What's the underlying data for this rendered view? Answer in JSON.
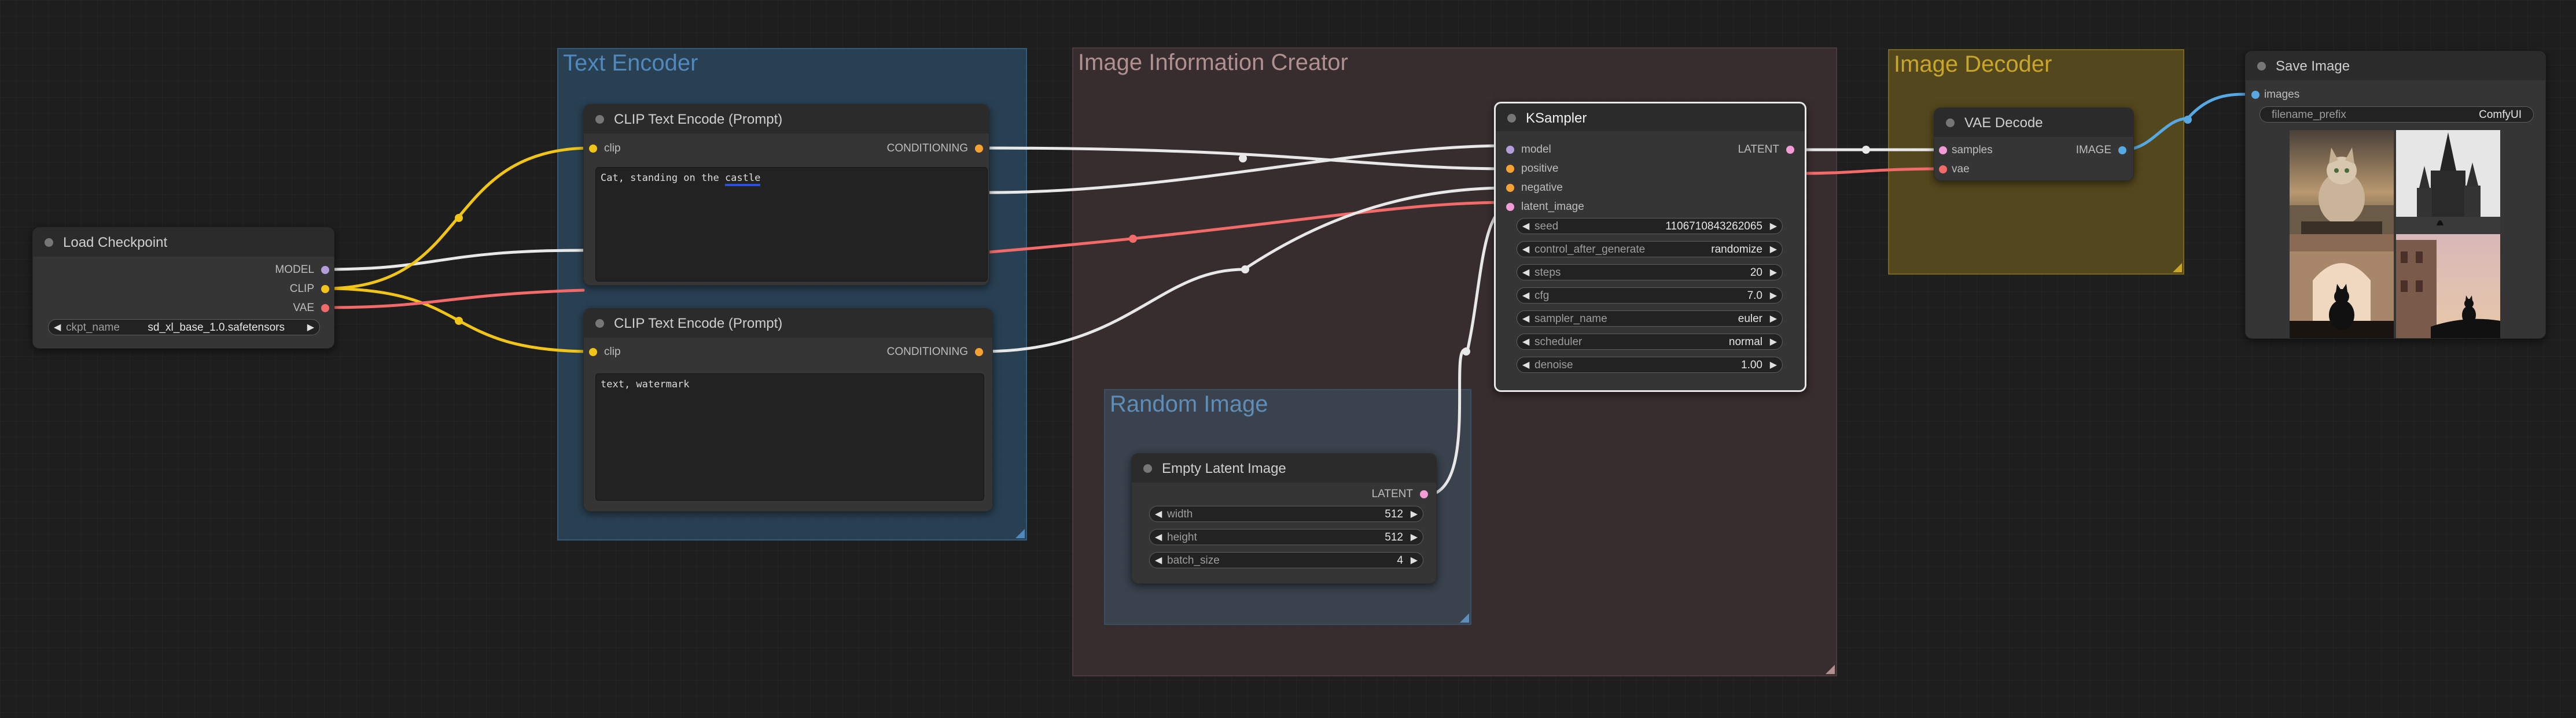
{
  "colors": {
    "background": "#1e1e1e",
    "wire_clip": "#f0c418",
    "wire_vae": "#f36a6a",
    "wire_image": "#58a8e3",
    "wire_default": "#e8e8e8",
    "slot_model": "#b39ddb",
    "slot_clip": "#f0c418",
    "slot_vae": "#f36a6a",
    "slot_conditioning": "#f6a233",
    "slot_latent": "#f29bd6",
    "slot_image": "#58a8e3"
  },
  "groups": {
    "text_encoder": {
      "title": "Text Encoder",
      "color": "#335d80",
      "title_color": "#4f89bd"
    },
    "image_information_creator": {
      "title": "Image Information Creator",
      "color": "#4f3b3d",
      "title_color": "#b09090"
    },
    "random_image": {
      "title": "Random Image",
      "color": "#3b5368",
      "title_color": "#5e8db8"
    },
    "image_decoder": {
      "title": "Image Decoder",
      "color": "#7f6a1d",
      "title_color": "#c9a52a"
    }
  },
  "nodes": {
    "load_checkpoint": {
      "title": "Load Checkpoint",
      "outputs": [
        "MODEL",
        "CLIP",
        "VAE"
      ],
      "widget": {
        "name": "ckpt_name",
        "value": "sd_xl_base_1.0.safetensors"
      }
    },
    "clip_encode_positive": {
      "title": "CLIP Text Encode (Prompt)",
      "input": "clip",
      "output": "CONDITIONING",
      "text_before": "Cat, standing on the ",
      "text_highlight": "castle"
    },
    "clip_encode_negative": {
      "title": "CLIP Text Encode (Prompt)",
      "input": "clip",
      "output": "CONDITIONING",
      "text": "text, watermark"
    },
    "ksampler": {
      "title": "KSampler",
      "inputs": [
        "model",
        "positive",
        "negative",
        "latent_image"
      ],
      "output": "LATENT",
      "widgets": [
        {
          "name": "seed",
          "value": "1106710843262065"
        },
        {
          "name": "control_after_generate",
          "value": "randomize"
        },
        {
          "name": "steps",
          "value": "20"
        },
        {
          "name": "cfg",
          "value": "7.0"
        },
        {
          "name": "sampler_name",
          "value": "euler"
        },
        {
          "name": "scheduler",
          "value": "normal"
        },
        {
          "name": "denoise",
          "value": "1.00"
        }
      ]
    },
    "empty_latent": {
      "title": "Empty Latent Image",
      "output": "LATENT",
      "widgets": [
        {
          "name": "width",
          "value": "512"
        },
        {
          "name": "height",
          "value": "512"
        },
        {
          "name": "batch_size",
          "value": "4"
        }
      ]
    },
    "vae_decode": {
      "title": "VAE Decode",
      "inputs": [
        "samples",
        "vae"
      ],
      "output": "IMAGE"
    },
    "save_image": {
      "title": "Save Image",
      "input": "images",
      "widget": {
        "name": "filename_prefix",
        "value": "ComfyUI"
      },
      "thumbnails": [
        "cat-sitting-thumbnail",
        "castle-thumbnail",
        "cat-in-archway-thumbnail",
        "cat-on-tower-thumbnail"
      ]
    }
  }
}
